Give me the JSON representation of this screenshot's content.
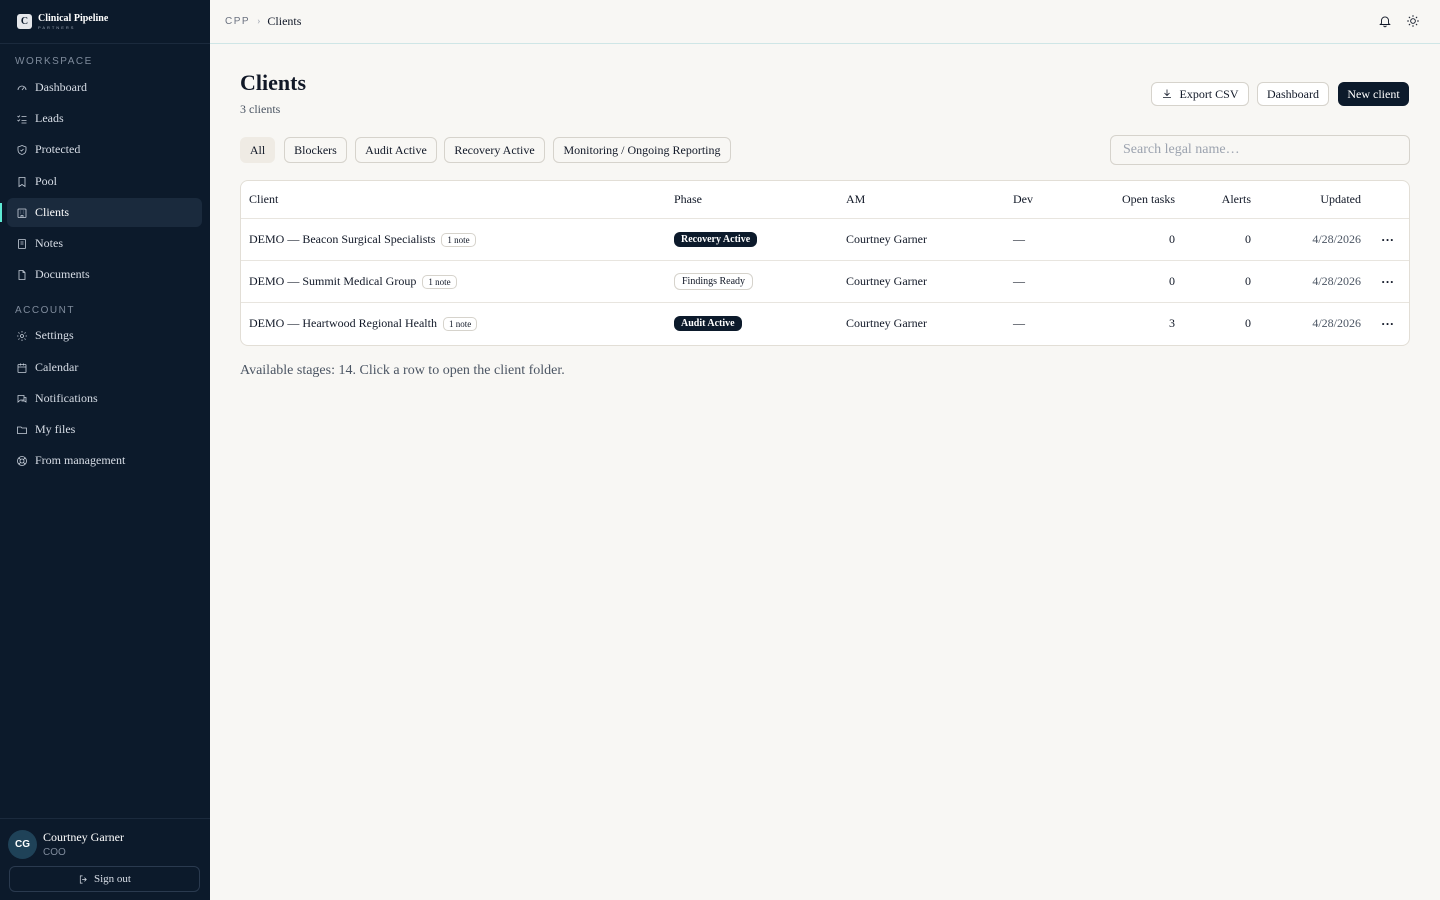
{
  "brand": {
    "name": "Clinical Pipeline",
    "sub": "PARTNERS",
    "logo_letter": "C"
  },
  "sidebar": {
    "section_workspace": "WORKSPACE",
    "section_account": "ACCOUNT",
    "workspace_items": [
      {
        "label": "Dashboard",
        "icon": "gauge-icon"
      },
      {
        "label": "Leads",
        "icon": "list-check-icon"
      },
      {
        "label": "Protected",
        "icon": "shield-icon"
      },
      {
        "label": "Pool",
        "icon": "bookmark-icon"
      },
      {
        "label": "Clients",
        "icon": "building-icon",
        "active": true
      },
      {
        "label": "Notes",
        "icon": "notebook-icon"
      },
      {
        "label": "Documents",
        "icon": "document-icon"
      }
    ],
    "account_items": [
      {
        "label": "Settings",
        "icon": "gear-icon"
      },
      {
        "label": "Calendar",
        "icon": "calendar-icon"
      },
      {
        "label": "Notifications",
        "icon": "chat-icon"
      },
      {
        "label": "My files",
        "icon": "folder-icon"
      },
      {
        "label": "From management",
        "icon": "lifebuoy-icon"
      }
    ]
  },
  "user": {
    "initials": "CG",
    "name": "Courtney Garner",
    "role": "COO",
    "signout": "Sign out"
  },
  "breadcrumb": {
    "root": "CPP",
    "current": "Clients"
  },
  "page": {
    "title": "Clients",
    "subtitle": "3 clients",
    "export_label": "Export CSV",
    "dashboard_label": "Dashboard",
    "new_label": "New client"
  },
  "filters": [
    "All",
    "Blockers",
    "Audit Active",
    "Recovery Active",
    "Monitoring / Ongoing Reporting"
  ],
  "search": {
    "placeholder": "Search legal name…"
  },
  "table": {
    "headers": {
      "client": "Client",
      "phase": "Phase",
      "am": "AM",
      "dev": "Dev",
      "open_tasks": "Open tasks",
      "alerts": "Alerts",
      "updated": "Updated"
    },
    "rows": [
      {
        "client": "DEMO — Beacon Surgical Specialists",
        "notes": "1 note",
        "phase": "Recovery Active",
        "phase_style": "dark",
        "am": "Courtney Garner",
        "dev": "—",
        "open_tasks": "0",
        "alerts": "0",
        "updated": "4/28/2026"
      },
      {
        "client": "DEMO — Summit Medical Group",
        "notes": "1 note",
        "phase": "Findings Ready",
        "phase_style": "light",
        "am": "Courtney Garner",
        "dev": "—",
        "open_tasks": "0",
        "alerts": "0",
        "updated": "4/28/2026"
      },
      {
        "client": "DEMO — Heartwood Regional Health",
        "notes": "1 note",
        "phase": "Audit Active",
        "phase_style": "dark",
        "am": "Courtney Garner",
        "dev": "—",
        "open_tasks": "3",
        "alerts": "0",
        "updated": "4/28/2026"
      }
    ],
    "row_menu": "···"
  },
  "footnote": "Available stages: 14. Click a row to open the client folder.",
  "colors": {
    "sidebar_bg": "#0c1a2b",
    "accent": "#5eead4",
    "page_bg": "#f8f7f4"
  }
}
